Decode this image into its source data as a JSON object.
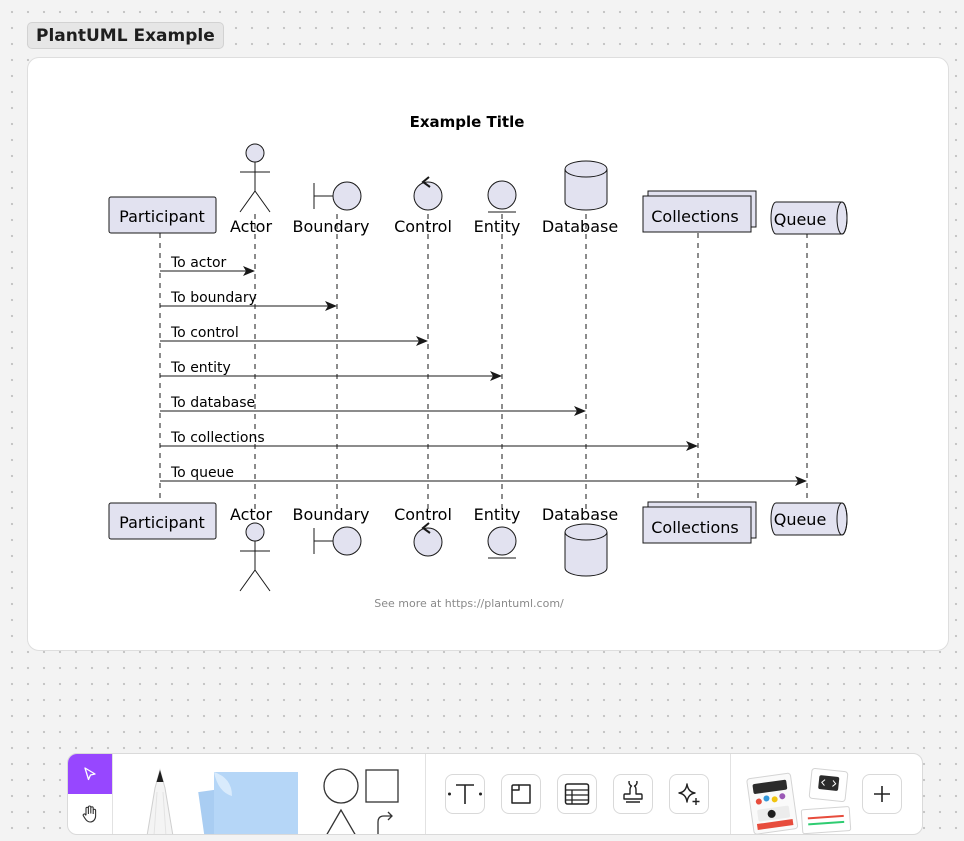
{
  "frame": {
    "label": "PlantUML Example"
  },
  "diagram": {
    "title": "Example Title",
    "participants": {
      "participant": "Participant",
      "actor": "Actor",
      "boundary": "Boundary",
      "control": "Control",
      "entity": "Entity",
      "database": "Database",
      "collections": "Collections",
      "queue": "Queue"
    },
    "messages": [
      "To actor",
      "To boundary",
      "To control",
      "To entity",
      "To database",
      "To collections",
      "To queue"
    ],
    "footer": "See more at https://plantuml.com/"
  },
  "toolbar": {
    "tools": [
      "pointer-icon",
      "hand-icon",
      "pen-icon",
      "sticky-note-icon",
      "shapes-icon",
      "text-icon",
      "section-icon",
      "table-icon",
      "stamp-icon",
      "ai-sparkle-icon",
      "plugins-icon",
      "plus-icon"
    ],
    "accent": "#9747ff"
  }
}
